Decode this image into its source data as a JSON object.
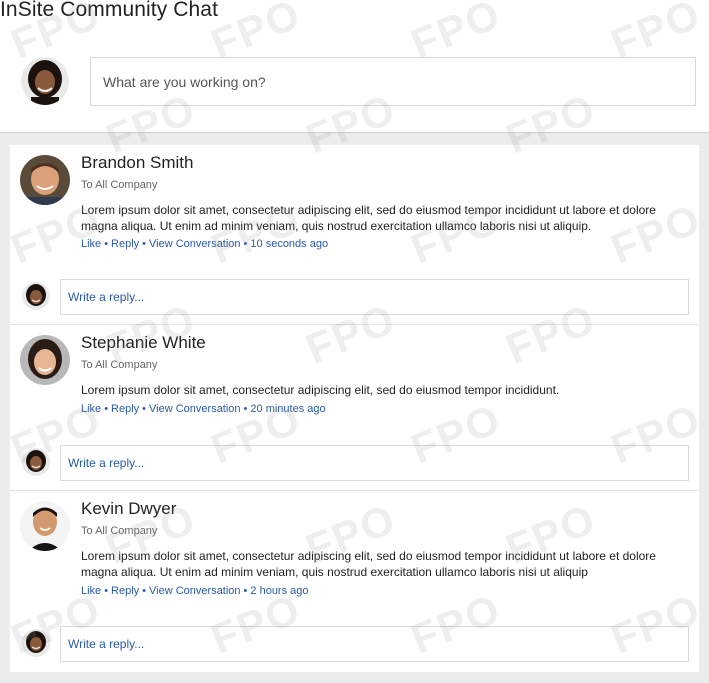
{
  "app": {
    "title": "InSite Community Chat"
  },
  "composer": {
    "placeholder": "What are you working on?"
  },
  "posts": [
    {
      "author": "Brandon Smith",
      "audience": "To All Company",
      "body": "Lorem ipsum dolor sit amet, consectetur adipiscing elit, sed do eiusmod tempor incididunt ut labore et dolore magna aliqua. Ut enim ad minim veniam, quis nostrud exercitation ullamco laboris nisi ut aliquip.",
      "like": "Like",
      "reply": "Reply",
      "view": "View Conversation",
      "time": "10 seconds ago",
      "reply_placeholder": "Write a reply..."
    },
    {
      "author": "Stephanie White",
      "audience": "To All Company",
      "body": "Lorem ipsum dolor sit amet, consectetur adipiscing elit, sed do eiusmod tempor incididunt.",
      "like": "Like",
      "reply": "Reply",
      "view": "View Conversation",
      "time": "20 minutes ago",
      "reply_placeholder": "Write a reply..."
    },
    {
      "author": "Kevin Dwyer",
      "audience": "To All Company",
      "body": "Lorem ipsum dolor sit amet, consectetur adipiscing elit, sed do eiusmod tempor incididunt ut labore et dolore magna aliqua. Ut enim ad minim veniam, quis nostrud exercitation ullamco laboris nisi ut aliquip",
      "like": "Like",
      "reply": "Reply",
      "view": "View Conversation",
      "time": "2 hours ago",
      "reply_placeholder": "Write a reply..."
    }
  ],
  "watermark": "FPO",
  "colors": {
    "link": "#2a5aa8",
    "feed_bg": "#ececec"
  },
  "icons": {
    "dot_separator": "•"
  }
}
